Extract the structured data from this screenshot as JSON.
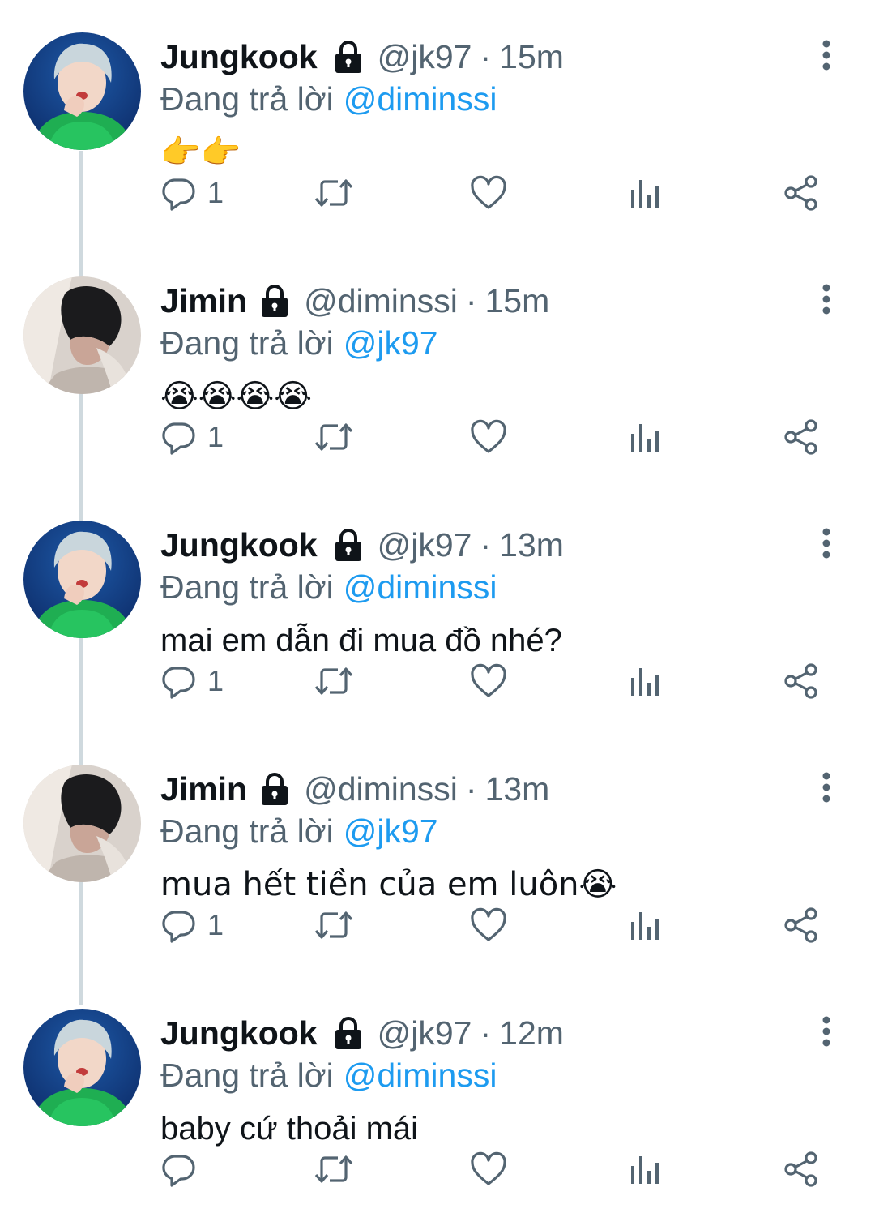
{
  "tweets": [
    {
      "name": "Jungkook",
      "handle": "@jk97",
      "separator": "·",
      "time": "15m",
      "reply_prefix": "Đang trả lời",
      "reply_to": "@diminssi",
      "text": "👉👉",
      "reply_count": "1",
      "avatar": "jungkook-avatar"
    },
    {
      "name": "Jimin",
      "handle": "@diminssi",
      "separator": "·",
      "time": "15m",
      "reply_prefix": "Đang trả lời",
      "reply_to": "@jk97",
      "text": "😭😭😭😭",
      "reply_count": "1",
      "avatar": "jimin-avatar"
    },
    {
      "name": "Jungkook",
      "handle": "@jk97",
      "separator": "·",
      "time": "13m",
      "reply_prefix": "Đang trả lời",
      "reply_to": "@diminssi",
      "text": "mai em dẫn đi mua đồ nhé?",
      "reply_count": "1",
      "avatar": "jungkook-avatar"
    },
    {
      "name": "Jimin",
      "handle": "@diminssi",
      "separator": "·",
      "time": "13m",
      "reply_prefix": "Đang trả lời",
      "reply_to": "@jk97",
      "text": "mua hết tiền của em luôn😭",
      "reply_count": "1",
      "avatar": "jimin-avatar"
    },
    {
      "name": "Jungkook",
      "handle": "@jk97",
      "separator": "·",
      "time": "12m",
      "reply_prefix": "Đang trả lời",
      "reply_to": "@diminssi",
      "text": "baby cứ thoải mái",
      "reply_count": "",
      "avatar": "jungkook-avatar"
    }
  ],
  "colors": {
    "accent": "#1d9bf0",
    "secondary_text": "#536471",
    "primary_text": "#0f1419",
    "thread_line": "#cfd9de"
  },
  "icons": [
    "lock-icon",
    "more-icon",
    "reply-icon",
    "retweet-icon",
    "like-icon",
    "views-icon",
    "share-icon"
  ]
}
